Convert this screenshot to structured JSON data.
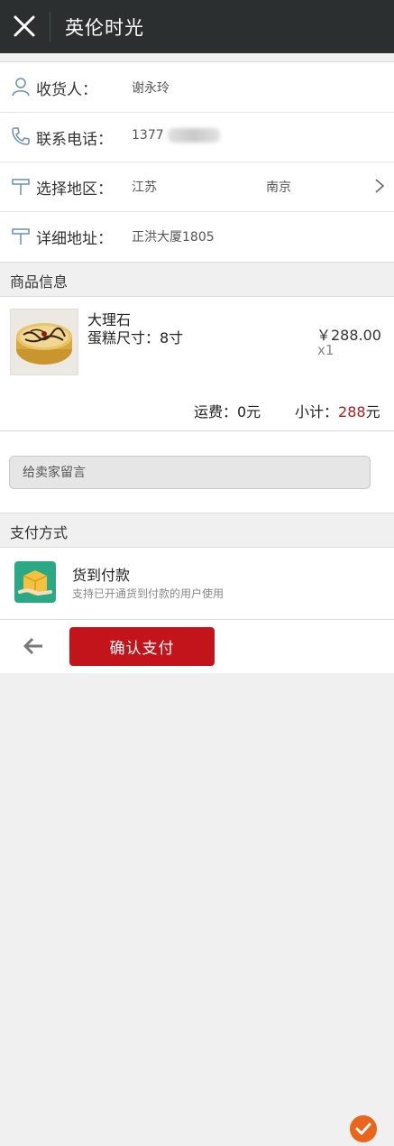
{
  "header": {
    "title": "英伦时光",
    "close_icon": "close-icon"
  },
  "address": {
    "recipient_label": "收货人：",
    "recipient_value": "谢永玲",
    "phone_label": "联系电话：",
    "phone_value": "1377",
    "region_label": "选择地区：",
    "province": "江苏",
    "city": "南京",
    "detail_label": "详细地址：",
    "detail_value": "正洪大厦1805"
  },
  "goods_section": {
    "title": "商品信息"
  },
  "product": {
    "name": "大理石",
    "size": "蛋糕尺寸：8寸",
    "price": "￥288.00",
    "qty": "x1"
  },
  "totals": {
    "shipping": "运费：0元",
    "subtotal_label": "小计：",
    "subtotal_value": "288",
    "subtotal_unit": "元"
  },
  "message": {
    "placeholder": "给卖家留言"
  },
  "payment_section": {
    "title": "支付方式"
  },
  "payment": {
    "title": "货到付款",
    "description": "支持已开通货到付款的用户使用",
    "selected": true
  },
  "footer": {
    "confirm_label": "确认支付"
  },
  "colors": {
    "accent": "#c3141b",
    "check": "#e9651c",
    "topbar": "#2c2f2f",
    "price_red": "#b01c1c"
  }
}
